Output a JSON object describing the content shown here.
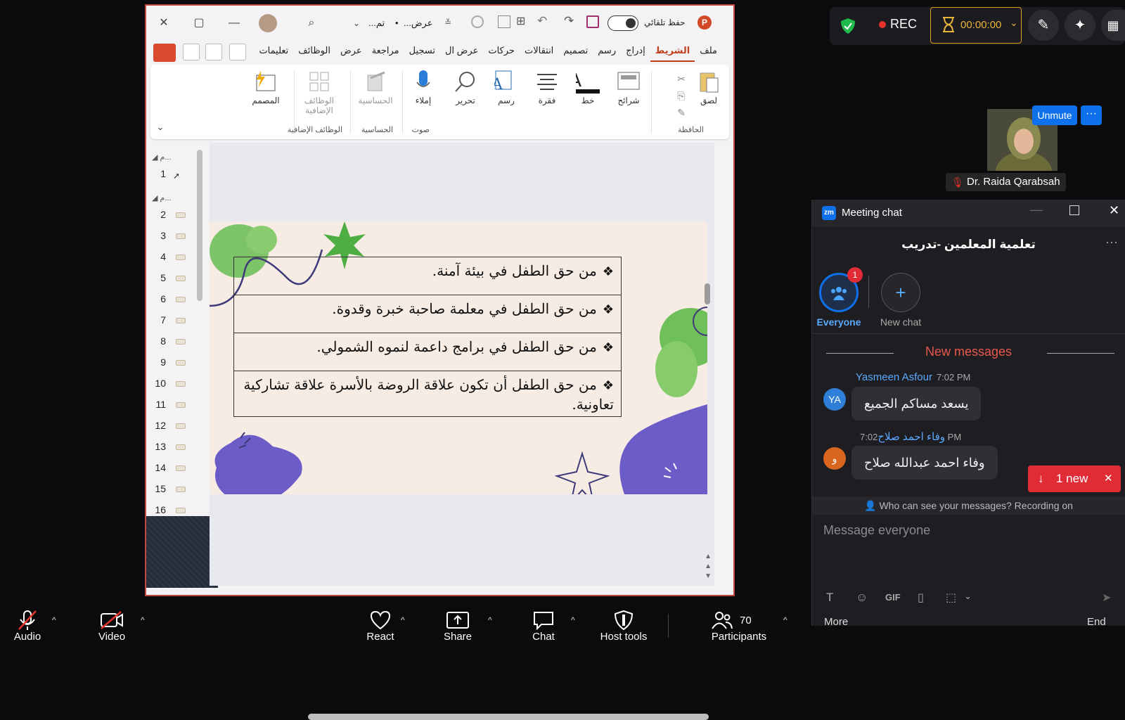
{
  "ppt": {
    "titlebar": {
      "doc_title": "عرض...",
      "doc_sub": "تم...",
      "autosave_label": "حفظ تلقائي"
    },
    "tabs": [
      "ملف",
      "الشريط",
      "إدراج",
      "رسم",
      "تصميم",
      "انتقالات",
      "حركات",
      "عرض ال",
      "تسجيل",
      "مراجعة",
      "عرض",
      "الوظائف",
      "تعليمات"
    ],
    "active_tab": "الشريط",
    "ribbon": {
      "buttons": {
        "paste": "لصق",
        "slides": "شرائح",
        "font": "خط",
        "paragraph": "فقرة",
        "draw": "رسم",
        "edit": "تحرير",
        "dictate": "إملاء",
        "sensitivity": "الحساسية",
        "addins": "الوظائف الإضافية",
        "designer": "المصمم"
      },
      "groups": {
        "clipboard": "الحافظة",
        "voice": "صوت",
        "sensitivity": "الحساسية",
        "addins": "الوظائف الإضافية"
      }
    },
    "thumbnails": [
      "1",
      "2",
      "3",
      "4",
      "5",
      "6",
      "7",
      "8",
      "9",
      "10",
      "11",
      "12",
      "13",
      "14",
      "15",
      "16"
    ],
    "section_label": "م...",
    "slide": {
      "rows": [
        "من حق الطفل في بيئة آمنة.",
        "من حق الطفل في معلمة صاحبة خبرة وقدوة.",
        "من حق الطفل في برامج داعمة لنموه الشمولي.",
        "من حق الطفل أن  تكون علاقة الروضة بالأسرة علاقة تشاركية تعاونية."
      ],
      "bullet": "❖"
    }
  },
  "zoom": {
    "rec_label": "REC",
    "timer": "00:00:00",
    "participant_name": "Dr. Raida Qarabsah",
    "unmute_label": "Unmute",
    "more_label": "···"
  },
  "chat": {
    "title": "Meeting chat",
    "group_name": "تعلمية المعلمين -تدريب",
    "tabs": {
      "everyone": "Everyone",
      "everyone_badge": "1",
      "new_chat": "New chat"
    },
    "new_messages_label": "New messages",
    "messages": [
      {
        "sender": "Yasmeen Asfour",
        "time": "7:02 PM",
        "initials": "YA",
        "text": "يسعد مساكم الجميع",
        "avatar_color": "#2f7ed8"
      },
      {
        "sender": "وفاء احمد صلاح",
        "time": "7:02 PM",
        "initials": "و",
        "text": "وفاء احمد عبدالله صلاح",
        "avatar_color": "#d9651f"
      }
    ],
    "new_pill": "1 new",
    "privacy_note": "Who can see your messages? Recording on",
    "input_placeholder": "Message everyone",
    "gif_label": "GIF"
  },
  "bottombar": {
    "audio": "Audio",
    "video": "Video",
    "react": "React",
    "share": "Share",
    "chat": "Chat",
    "host_tools": "Host tools",
    "participants": "Participants",
    "participants_count": "70",
    "more": "More",
    "end": "End"
  },
  "colors": {
    "accent_blue": "#0e71eb",
    "rec_red": "#e5322d",
    "timer_gold": "#e9b43c",
    "ppt_accent": "#c43e1c"
  }
}
